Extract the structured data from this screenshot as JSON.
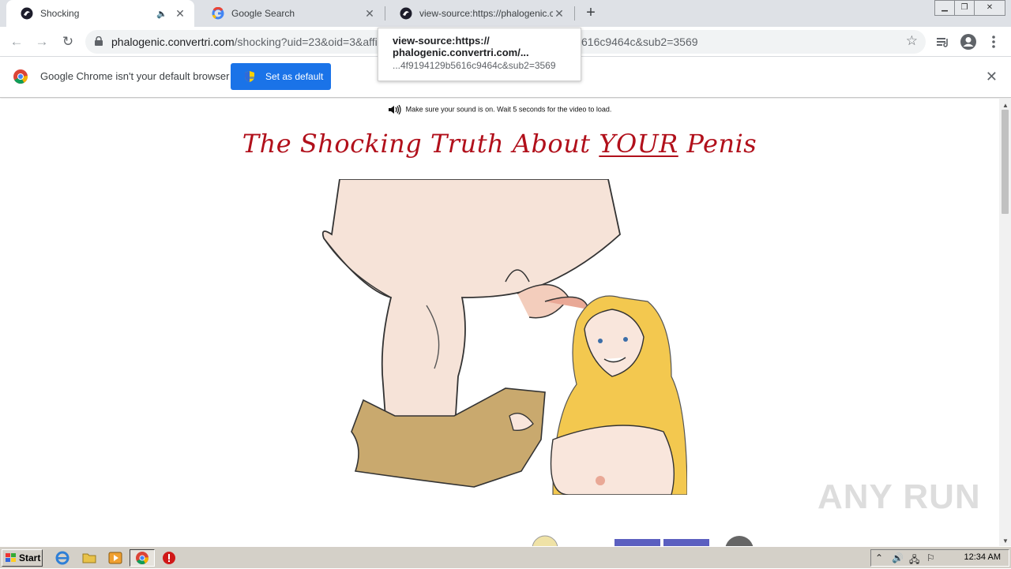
{
  "tabs": [
    {
      "title": "Shocking",
      "active": true,
      "audio": true
    },
    {
      "title": "Google Search",
      "active": false
    },
    {
      "title": "view-source:https://phalogenic.con",
      "active": false
    }
  ],
  "address_bar": {
    "host": "phalogenic.convertri.com",
    "path": "/shocking?uid=23&oid=3&affi",
    "path_tail": "616c9464c&sub2=3569"
  },
  "tooltip": {
    "line1": "view-source:https://",
    "line2": "phalogenic.convertri.com/...",
    "line3": "...4f9194129b5616c9464c&sub2=3569"
  },
  "infobar": {
    "message": "Google Chrome isn't your default browser",
    "button": "Set as default"
  },
  "page": {
    "sound_note": "Make sure your sound is on. Wait 5 seconds for the video to load.",
    "headline_pre": "The Shocking Truth About ",
    "headline_emph": "YOUR",
    "headline_post": " Penis"
  },
  "watermark": "ANY RUN",
  "taskbar": {
    "start": "Start",
    "clock": "12:34 AM"
  },
  "colors": {
    "headline": "#b1101b",
    "button_blue": "#1a73e8"
  }
}
